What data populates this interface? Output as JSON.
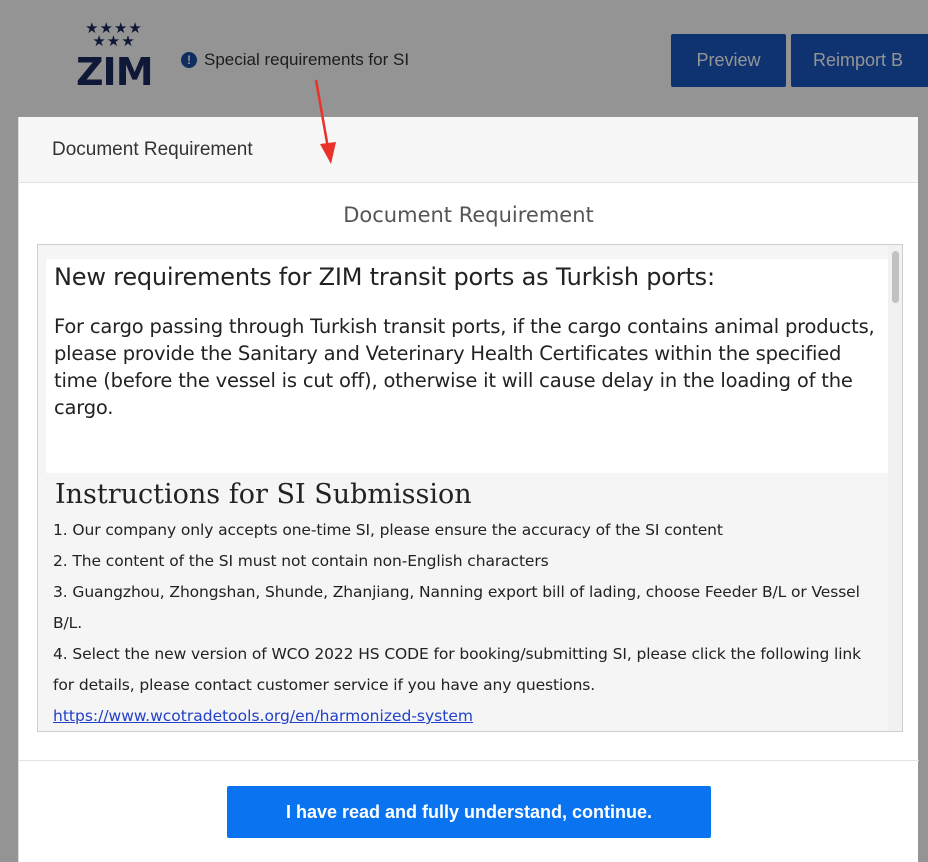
{
  "app": {
    "logo_text": "ZIM",
    "notice_text": "Special requirements for SI",
    "notice_icon": "info-icon",
    "preview_label": "Preview",
    "reimport_label": "Reimport B"
  },
  "modal": {
    "header_title": "Document Requirement",
    "subtitle": "Document Requirement",
    "panel": {
      "title": "New requirements for ZIM transit ports as Turkish ports:",
      "body": "For cargo passing through Turkish transit ports, if the cargo contains animal products, please provide the Sanitary and Veterinary Health Certificates within the specified time (before the vessel is cut off), otherwise it will cause delay in the loading of the cargo."
    },
    "instructions": {
      "title": "Instructions for SI Submission",
      "items": [
        "1. Our company only accepts one-time SI, please ensure the accuracy of the SI content",
        "2. The content of the SI must not contain non-English characters",
        "3. Guangzhou, Zhongshan, Shunde, Zhanjiang, Nanning export bill of lading, choose Feeder B/L or Vessel B/L.",
        "4. Select the new version of WCO 2022 HS CODE for booking/submitting SI, please click the following link for details, please contact customer service if you have any questions."
      ],
      "link": "https://www.wcotradetools.org/en/harmonized-system"
    },
    "continue_label": "I have read and fully understand, continue."
  },
  "colors": {
    "primary_button": "#0a74f0",
    "header_button": "#1b58c2",
    "annotation_arrow": "#e8322a",
    "link": "#2340c8"
  }
}
